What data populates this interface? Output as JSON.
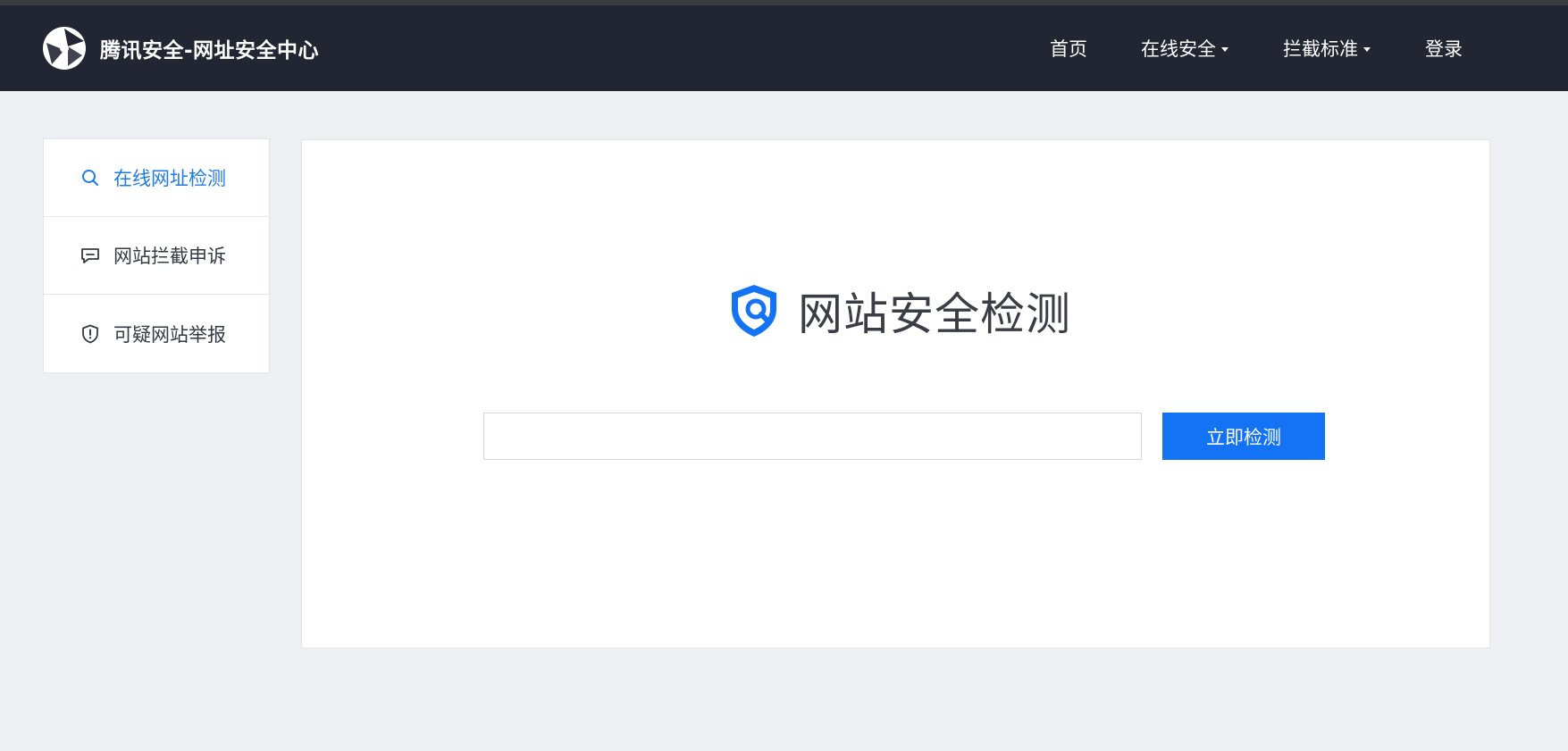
{
  "header": {
    "title": "腾讯安全-网址安全中心",
    "nav": [
      {
        "label": "首页",
        "has_dropdown": false
      },
      {
        "label": "在线安全",
        "has_dropdown": true
      },
      {
        "label": "拦截标准",
        "has_dropdown": true
      },
      {
        "label": "登录",
        "has_dropdown": false
      }
    ]
  },
  "sidebar": {
    "items": [
      {
        "label": "在线网址检测",
        "icon": "search-icon",
        "active": true
      },
      {
        "label": "网站拦截申诉",
        "icon": "chat-icon",
        "active": false
      },
      {
        "label": "可疑网站举报",
        "icon": "shield-alert-icon",
        "active": false
      }
    ]
  },
  "main": {
    "hero_title": "网站安全检测",
    "url_input": {
      "value": "",
      "placeholder": ""
    },
    "check_button_label": "立即检测"
  },
  "colors": {
    "header_bg": "#222532",
    "page_bg": "#eeeff3",
    "accent": "#1473f5",
    "active_link": "#1e7be7"
  }
}
